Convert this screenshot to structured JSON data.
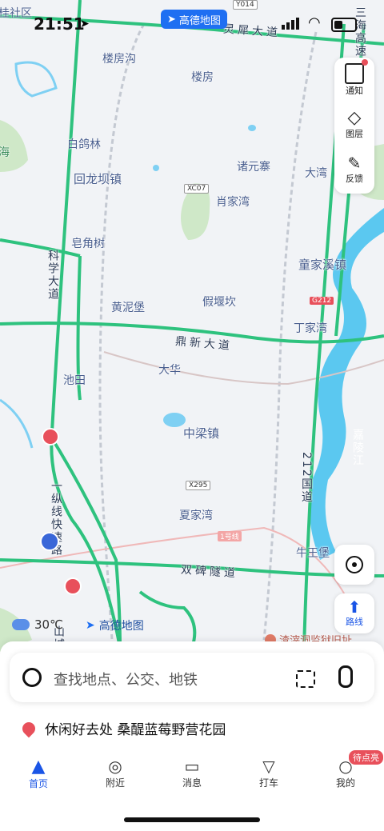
{
  "status": {
    "time": "21:51"
  },
  "brand": {
    "name": "高德地图"
  },
  "map": {
    "places": [
      "楼房沟",
      "楼房",
      "白鸽林",
      "回龙坝镇",
      "诸元寨",
      "大湾",
      "肖家湾",
      "皂角树",
      "童家溪镇",
      "黄泥堡",
      "假堰坎",
      "丁家湾",
      "大华",
      "池田",
      "中梁镇",
      "夏家湾",
      "牛王堡"
    ],
    "edge_labels": {
      "top_left": "桂社区",
      "left_sea": "海"
    },
    "roads": {
      "lingwu": "灵犀大道",
      "dingxin": "鼎新大道",
      "shuangbei": "双碑隧道",
      "kexue": "科学大道",
      "yizong": "一纵线快速路",
      "g212_road": "212国道",
      "sanhai": "三海高速",
      "jialing": "嘉陵江",
      "shancheng": "山城"
    },
    "codes": {
      "xc07": "XC07",
      "x295": "X295",
      "g212": "G212",
      "y014": "Y014",
      "line1": "1号线"
    },
    "poi": "渣滓洞监狱旧址",
    "weather": "30℃",
    "watermark": "高德地图"
  },
  "right_panel": {
    "items": [
      {
        "label": "通知",
        "icon": "notice-icon"
      },
      {
        "label": "图层",
        "icon": "layers-icon"
      },
      {
        "label": "反馈",
        "icon": "feedback-icon"
      }
    ]
  },
  "route_button": {
    "label": "路线"
  },
  "search": {
    "placeholder": "查找地点、公交、地铁"
  },
  "tip": {
    "text": "休闲好去处 桑醍蓝莓野营花园"
  },
  "tabs": [
    {
      "label": "首页",
      "icon": "home-icon",
      "active": true
    },
    {
      "label": "附近",
      "icon": "location-pin-icon"
    },
    {
      "label": "消息",
      "icon": "message-icon"
    },
    {
      "label": "打车",
      "icon": "taxi-icon"
    },
    {
      "label": "我的",
      "icon": "user-icon",
      "badge": "待点亮"
    }
  ],
  "colors": {
    "accent": "#1f6ff2",
    "road": "#2ec27e",
    "river": "#5bc8f0",
    "badge": "#e8505b"
  }
}
